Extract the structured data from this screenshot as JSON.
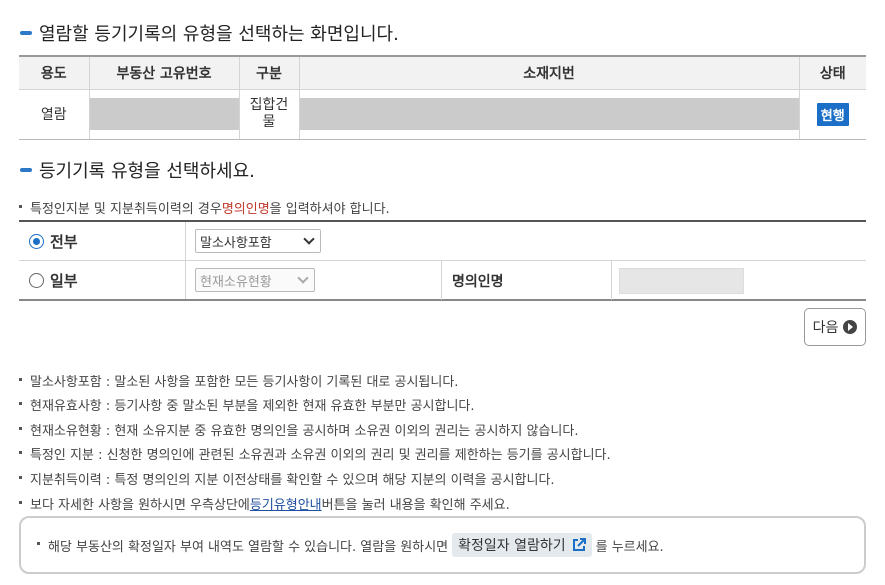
{
  "section1": {
    "title": "열람할 등기기록의 유형을 선택하는 화면입니다."
  },
  "table": {
    "headers": [
      "용도",
      "부동산 고유번호",
      "구분",
      "소재지번",
      "상태"
    ],
    "row": {
      "usage": "열람",
      "category": "집합건물",
      "status": "현행"
    }
  },
  "section2": {
    "title": "등기기록 유형을 선택하세요."
  },
  "note": {
    "prefix": "특정인지분 및 지분취득이력의 경우 ",
    "highlight": "명의인명",
    "suffix": "을 입력하셔야 합니다."
  },
  "options": {
    "all": {
      "label": "전부",
      "checked": true,
      "select_value": "말소사항포함"
    },
    "partial": {
      "label": "일부",
      "checked": false,
      "select_value": "현재소유현황"
    },
    "holder_label": "명의인명"
  },
  "next_button": {
    "label": "다음"
  },
  "info_list": [
    "말소사항포함 : 말소된 사항을 포함한 모든 등기사항이 기록된 대로 공시됩니다.",
    "현재유효사항 : 등기사항 중 말소된 부분을 제외한 현재 유효한 부분만 공시합니다.",
    "현재소유현황 : 현재 소유지분 중 유효한 명의인을 공시하며 소유권 이외의 권리는 공시하지 않습니다.",
    "특정인 지분 : 신청한 명의인에 관련된 소유권과 소유권 이외의 권리 및 권리를 제한하는 등기를 공시합니다.",
    "지분취득이력 : 특정 명의인의 지분 이전상태를 확인할 수 있으며 해당 지분의 이력을 공시합니다."
  ],
  "guide_line": {
    "prefix": "보다 자세한 사항을 원하시면 우측상단에 ",
    "link": "등기유형안내",
    "suffix": "버튼을 눌러 내용을 확인해 주세요."
  },
  "bottom_box": {
    "prefix": "해당 부동산의 확정일자 부여 내역도 열람할 수 있습니다. 열람을 원하시면",
    "button": "확정일자 열람하기",
    "suffix": "를 누르세요."
  },
  "colors": {
    "accent": "#1b6fc7",
    "highlight_red": "#c0392b",
    "link": "#1f4fa0"
  }
}
